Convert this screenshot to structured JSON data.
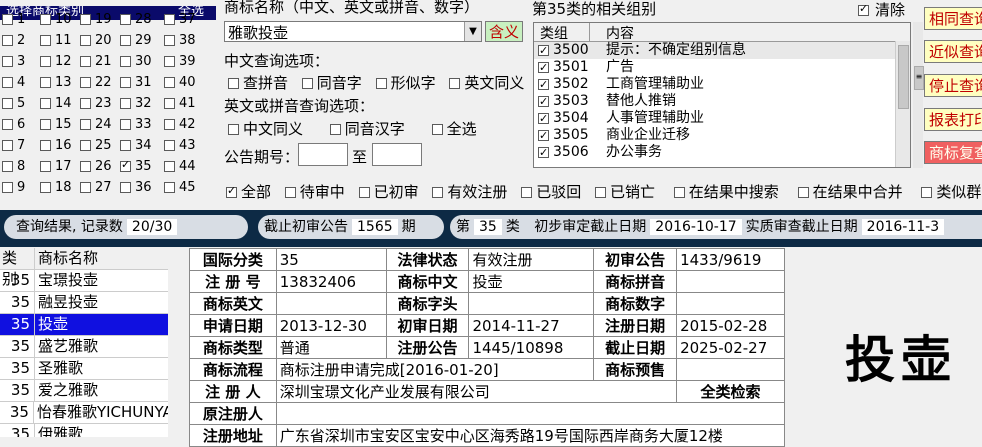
{
  "class_panel": {
    "header": "选择商标类别",
    "all_label": "全选",
    "classes": [
      {
        "n": "1",
        "on": false
      },
      {
        "n": "2",
        "on": false
      },
      {
        "n": "3",
        "on": false
      },
      {
        "n": "4",
        "on": false
      },
      {
        "n": "5",
        "on": false
      },
      {
        "n": "6",
        "on": false
      },
      {
        "n": "7",
        "on": false
      },
      {
        "n": "8",
        "on": false
      },
      {
        "n": "9",
        "on": false
      },
      {
        "n": "10",
        "on": false
      },
      {
        "n": "11",
        "on": false
      },
      {
        "n": "12",
        "on": false
      },
      {
        "n": "13",
        "on": false
      },
      {
        "n": "14",
        "on": false
      },
      {
        "n": "15",
        "on": false
      },
      {
        "n": "16",
        "on": false
      },
      {
        "n": "17",
        "on": false
      },
      {
        "n": "18",
        "on": false
      },
      {
        "n": "19",
        "on": false
      },
      {
        "n": "20",
        "on": false
      },
      {
        "n": "21",
        "on": false
      },
      {
        "n": "22",
        "on": false
      },
      {
        "n": "23",
        "on": false
      },
      {
        "n": "24",
        "on": false
      },
      {
        "n": "25",
        "on": false
      },
      {
        "n": "26",
        "on": false
      },
      {
        "n": "27",
        "on": false
      },
      {
        "n": "28",
        "on": false
      },
      {
        "n": "29",
        "on": false
      },
      {
        "n": "30",
        "on": false
      },
      {
        "n": "31",
        "on": false
      },
      {
        "n": "32",
        "on": false
      },
      {
        "n": "33",
        "on": false
      },
      {
        "n": "34",
        "on": false
      },
      {
        "n": "35",
        "on": true
      },
      {
        "n": "36",
        "on": false
      },
      {
        "n": "37",
        "on": false
      },
      {
        "n": "38",
        "on": false
      },
      {
        "n": "39",
        "on": false
      },
      {
        "n": "40",
        "on": false
      },
      {
        "n": "41",
        "on": false
      },
      {
        "n": "42",
        "on": false
      },
      {
        "n": "43",
        "on": false
      },
      {
        "n": "44",
        "on": false
      },
      {
        "n": "45",
        "on": false
      }
    ]
  },
  "query": {
    "name_label": "商标名称（中文、英文或拼音、数字）",
    "name_value": "雅歌投壶",
    "contains_button": "含义",
    "cn_options_label": "中文查询选项：",
    "cn_options": [
      "查拼音",
      "同音字",
      "形似字",
      "英文同义"
    ],
    "en_options_label": "英文或拼音查询选项：",
    "en_options": [
      "中文同义",
      "同音汉字",
      "全选"
    ],
    "issue_label": "公告期号：",
    "issue_to": "至"
  },
  "groups": {
    "title": "第35类的相关组别",
    "clear_label": "清除",
    "col_group": "类组",
    "col_content": "内容",
    "rows": [
      {
        "code": "3500",
        "text": "提示：不确定组别信息"
      },
      {
        "code": "3501",
        "text": "广告"
      },
      {
        "code": "3502",
        "text": "工商管理辅助业"
      },
      {
        "code": "3503",
        "text": "替他人推销"
      },
      {
        "code": "3504",
        "text": "人事管理辅助业"
      },
      {
        "code": "3505",
        "text": "商业企业迁移"
      },
      {
        "code": "3506",
        "text": "办公事务"
      }
    ]
  },
  "buttons": [
    "相同查询",
    "近似查询",
    "停止查询",
    "报表打印",
    "商标复查"
  ],
  "filters": [
    "全部",
    "待审中",
    "已初审",
    "有效注册",
    "已驳回",
    "已销亡",
    "在结果中搜索",
    "在结果中合并",
    "类似群"
  ],
  "status": {
    "result_label": "查询结果, 记录数",
    "result_value": "20/30",
    "cutoff_label": "截止初审公告",
    "cutoff_value": "1565",
    "cutoff_unit": "期",
    "class_prefix": "第",
    "class_value": "35",
    "class_suffix": "类",
    "prelim_label": "初步审定截止日期",
    "prelim_value": "2016-10-17",
    "subst_label": "实质审查截止日期",
    "subst_value": "2016-11-3"
  },
  "result_list": {
    "col_class": "类别",
    "col_name": "商标名称",
    "rows": [
      {
        "cls": "35",
        "name": "宝璟投壶"
      },
      {
        "cls": "35",
        "name": "融昱投壶"
      },
      {
        "cls": "35",
        "name": "投壶"
      },
      {
        "cls": "35",
        "name": "盛艺雅歌"
      },
      {
        "cls": "35",
        "name": "圣雅歌"
      },
      {
        "cls": "35",
        "name": "爱之雅歌"
      },
      {
        "cls": "35",
        "name": "怡春雅歌YICHUNYA"
      },
      {
        "cls": "35",
        "name": "伊雅歌"
      }
    ]
  },
  "detail": {
    "l_intl_class": "国际分类",
    "intl_class": "35",
    "l_legal": "法律状态",
    "legal": "有效注册",
    "l_prelim": "初审公告",
    "prelim": "1433/9619",
    "l_regno": "注 册 号",
    "regno": "13832406",
    "l_cn": "商标中文",
    "cn": "投壶",
    "l_py": "商标拼音",
    "py": "",
    "l_en": "商标英文",
    "en": "",
    "l_head": "商标字头",
    "head": "",
    "l_num": "商标数字",
    "num": "",
    "l_apply_date": "申请日期",
    "apply_date": "2013-12-30",
    "l_prelim_date": "初审日期",
    "prelim_date": "2014-11-27",
    "l_reg_date": "注册日期",
    "reg_date": "2015-02-28",
    "l_type": "商标类型",
    "type": "普通",
    "l_reg_notice": "注册公告",
    "reg_notice": "1445/10898",
    "l_expire": "截止日期",
    "expire": "2025-02-27",
    "l_flow": "商标流程",
    "flow": "商标注册申请完成[2016-01-20]",
    "l_presale": "商标预售",
    "presale": "",
    "l_registrant": "注 册 人",
    "registrant": "深圳宝璟文化产业发展有限公司",
    "full_search": "全类检索",
    "l_orig": "原注册人",
    "orig": "",
    "l_addr": "注册地址",
    "addr": "广东省深圳市宝安区宝安中心区海秀路19号国际西岸商务大厦12楼"
  },
  "preview_text": "投壶"
}
